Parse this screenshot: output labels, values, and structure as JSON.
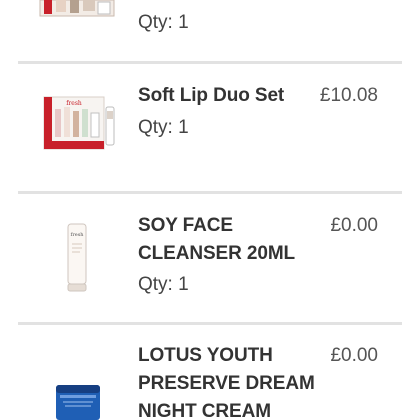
{
  "cart": {
    "items": [
      {
        "qty_prefix": "Qty:",
        "qty": "1"
      },
      {
        "name": "Soft Lip Duo Set",
        "price": "£10.08",
        "qty_prefix": "Qty:",
        "qty": "1",
        "image_icon": "lip-duo-gift-box-icon",
        "brand_mark": "fresh"
      },
      {
        "name_line1": "SOY FACE",
        "name_line2": "CLEANSER 20ML",
        "price": "£0.00",
        "qty_prefix": "Qty:",
        "qty": "1",
        "image_icon": "cleanser-tube-icon",
        "brand_mark": "fresh"
      },
      {
        "name_line1": "LOTUS YOUTH",
        "name_line2": "PRESERVE DREAM",
        "name_line3": "NIGHT CREAM",
        "price": "£0.00",
        "image_icon": "night-cream-jar-icon"
      }
    ]
  },
  "colors": {
    "divider": "#e2e2e2",
    "text": "#333333",
    "jar_blue": "#1f5fb5",
    "box_red": "#c8202a"
  }
}
